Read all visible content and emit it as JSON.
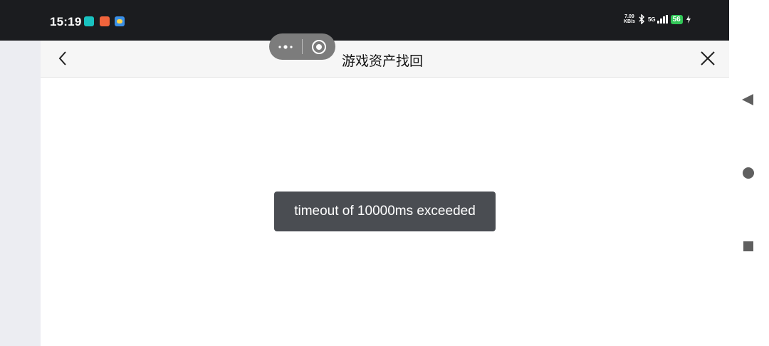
{
  "status_bar": {
    "time": "15:19",
    "net_speed_value": "7.09",
    "net_speed_unit": "KB/s",
    "network_type": "5G",
    "battery_level": "56",
    "notification_icons": [
      "taptap-app-icon",
      "red-app-icon",
      "weather-app-icon"
    ]
  },
  "nav": {
    "title": "游戏资产找回"
  },
  "toast": {
    "message": "timeout of 10000ms exceeded"
  },
  "colors": {
    "status_bar_bg": "#1b1c1f",
    "nav_bg": "#f6f6f6",
    "toast_bg": "#4a4d52",
    "battery": "#32c758"
  }
}
